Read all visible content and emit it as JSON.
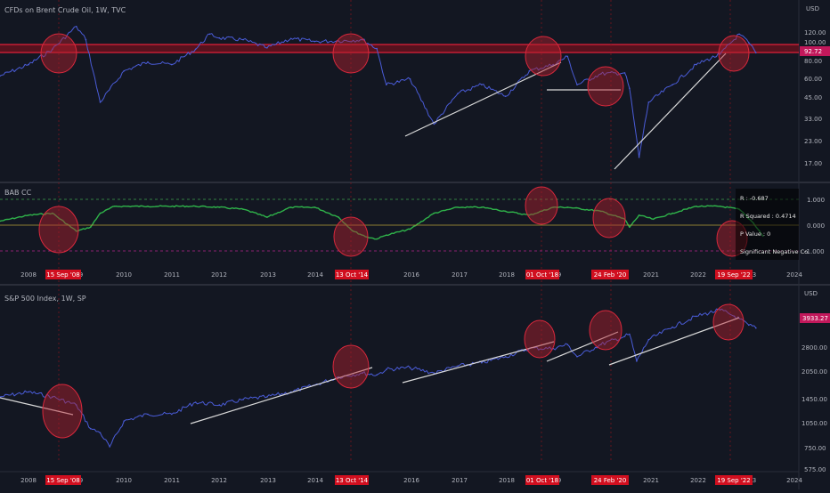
{
  "top_pane": {
    "title": "CFDs on Brent Crude Oil, 1W, TVC",
    "currency": "USD",
    "last_price": "92.72",
    "y_ticks": [
      "120.00",
      "100.00",
      "80.00",
      "60.00",
      "45.00",
      "33.00",
      "23.00",
      "17.00"
    ]
  },
  "indicator_pane": {
    "title": "BAB CC",
    "y_ticks": [
      "1.000",
      "0.000",
      "-1.000"
    ],
    "stats": [
      "R : -0.687",
      "R Squared : 0.4714",
      "P Value : 0",
      "Significant Negative Co"
    ]
  },
  "bottom_pane": {
    "title": "S&P 500 Index, 1W, SP",
    "currency": "USD",
    "last_price": "3933.27",
    "y_ticks": [
      "2800.00",
      "2050.00",
      "1450.00",
      "1050.00",
      "750.00",
      "575.00"
    ]
  },
  "time_axis": {
    "years": [
      "2008",
      "2010",
      "2011",
      "2012",
      "2013",
      "2014",
      "2016",
      "2017",
      "2018",
      "2021",
      "2022",
      "2024"
    ],
    "event_labels": [
      "15 Sep '08",
      "13 Oct '14",
      "01 Oct '18",
      "24 Feb '20",
      "19 Sep '22"
    ],
    "partial_years": [
      "9",
      "9",
      "3"
    ]
  },
  "colors": {
    "background": "#131722",
    "price_line": "#4a5cd8",
    "up_wick": "#e04a9a",
    "event_marker": "#d10f1f",
    "circle_fill": "#b5222f",
    "correlation_line": "#2fb34a",
    "resistance_band": "#c8102e",
    "trendline": "#d9d9d9"
  },
  "chart_data": [
    {
      "type": "line",
      "title": "CFDs on Brent Crude Oil, 1W, TVC",
      "xlabel": "",
      "ylabel": "USD",
      "log_scale": true,
      "ylim": [
        14,
        150
      ],
      "x": [
        2006.9,
        2007.5,
        2008.0,
        2008.5,
        2008.7,
        2009.0,
        2009.5,
        2010.0,
        2010.5,
        2011.0,
        2011.3,
        2011.5,
        2012.0,
        2012.5,
        2013.0,
        2013.5,
        2014.0,
        2014.5,
        2014.8,
        2015.0,
        2015.5,
        2016.0,
        2016.5,
        2017.0,
        2017.5,
        2018.0,
        2018.5,
        2018.8,
        2019.0,
        2019.5,
        2020.0,
        2020.1,
        2020.3,
        2020.5,
        2021.0,
        2021.5,
        2022.0,
        2022.4,
        2022.6,
        2022.75
      ],
      "values": [
        63,
        75,
        95,
        135,
        110,
        42,
        68,
        78,
        75,
        95,
        120,
        113,
        110,
        97,
        112,
        107,
        108,
        110,
        96,
        55,
        60,
        30,
        48,
        55,
        46,
        68,
        75,
        85,
        55,
        65,
        66,
        52,
        18,
        42,
        55,
        75,
        88,
        120,
        105,
        90
      ],
      "grid": false,
      "legend": "none"
    },
    {
      "type": "line",
      "title": "BAB CC",
      "ylim": [
        -1.3,
        1.3
      ],
      "x": [
        2006.9,
        2007.5,
        2008.0,
        2008.5,
        2008.8,
        2009.0,
        2009.3,
        2010.0,
        2011.0,
        2011.5,
        2012.0,
        2012.5,
        2013.0,
        2013.5,
        2014.0,
        2014.3,
        2014.6,
        2014.8,
        2015.0,
        2015.5,
        2016.0,
        2016.5,
        2017.0,
        2017.5,
        2018.0,
        2018.5,
        2018.8,
        2019.5,
        2020.0,
        2020.1,
        2020.3,
        2020.6,
        2021.0,
        2021.5,
        2022.0,
        2022.4,
        2022.7,
        2022.9
      ],
      "values": [
        0.2,
        0.5,
        0.6,
        -0.3,
        -0.1,
        0.6,
        0.95,
        0.95,
        0.95,
        0.9,
        0.8,
        0.4,
        0.9,
        0.9,
        0.4,
        -0.3,
        -0.6,
        -0.7,
        -0.5,
        -0.2,
        0.6,
        0.9,
        0.9,
        0.7,
        0.5,
        0.9,
        0.9,
        0.7,
        0.3,
        -0.1,
        0.5,
        0.3,
        0.6,
        0.95,
        0.95,
        0.8,
        0.1,
        -0.55
      ],
      "grid": false,
      "legend": "none"
    },
    {
      "type": "line",
      "title": "S&P 500 Index, 1W, SP",
      "xlabel": "",
      "ylabel": "USD",
      "log_scale": true,
      "ylim": [
        560,
        5200
      ],
      "x": [
        2006.9,
        2007.5,
        2008.0,
        2008.5,
        2008.8,
        2009.0,
        2009.2,
        2009.5,
        2010.0,
        2010.5,
        2011.0,
        2011.5,
        2012.0,
        2012.5,
        2013.0,
        2013.5,
        2014.0,
        2014.5,
        2014.8,
        2015.0,
        2015.5,
        2016.0,
        2016.5,
        2017.0,
        2017.5,
        2018.0,
        2018.5,
        2018.8,
        2019.0,
        2019.5,
        2020.0,
        2020.1,
        2020.25,
        2020.5,
        2021.0,
        2021.5,
        2022.0,
        2022.3,
        2022.6,
        2022.75
      ],
      "values": [
        1400,
        1500,
        1400,
        1250,
        900,
        850,
        700,
        1000,
        1100,
        1100,
        1300,
        1250,
        1350,
        1400,
        1500,
        1650,
        1850,
        1950,
        1900,
        2050,
        2100,
        1950,
        2150,
        2250,
        2450,
        2750,
        2750,
        2900,
        2450,
        2900,
        3250,
        3350,
        2300,
        3100,
        3700,
        4300,
        4700,
        4300,
        3800,
        3650
      ],
      "grid": false,
      "legend": "none"
    }
  ]
}
